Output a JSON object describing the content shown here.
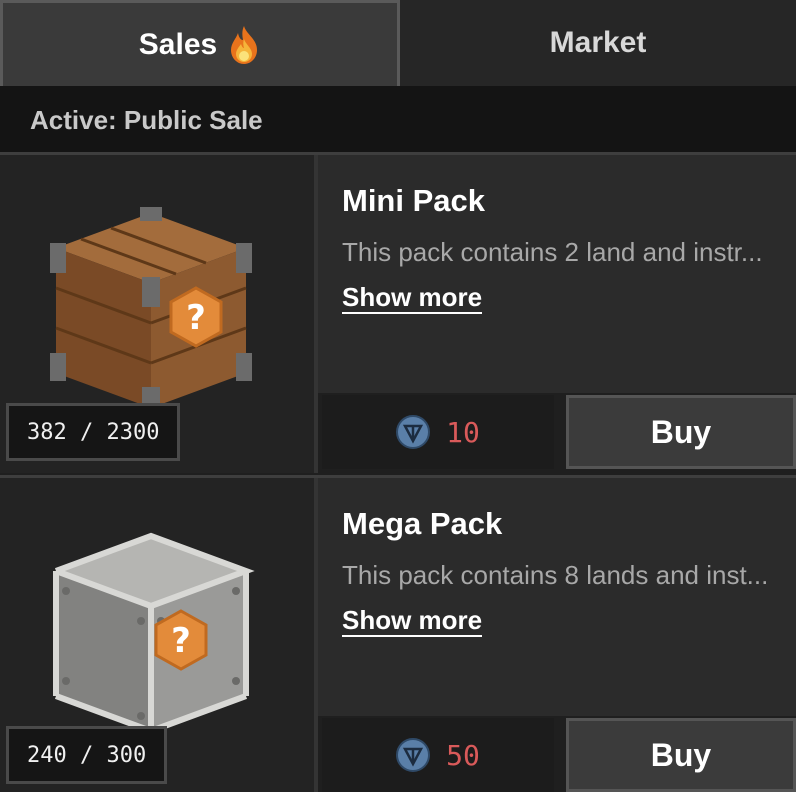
{
  "tabs": [
    {
      "label": "Sales",
      "icon": "flame-icon",
      "active": true
    },
    {
      "label": "Market",
      "active": false
    }
  ],
  "active_label": "Active: Public Sale",
  "packs": [
    {
      "title": "Mini Pack",
      "description": "This pack contains 2 land and instr...",
      "show_more": "Show more",
      "stock": "382 / 2300",
      "price": "10",
      "currency_icon": "ton-coin-icon",
      "buy_label": "Buy",
      "crate": "wooden-crate"
    },
    {
      "title": "Mega Pack",
      "description": "This pack contains 8 lands and inst...",
      "show_more": "Show more",
      "stock": "240 / 300",
      "price": "50",
      "currency_icon": "ton-coin-icon",
      "buy_label": "Buy",
      "crate": "metal-crate"
    }
  ],
  "colors": {
    "price": "#d95a5a",
    "coin": "#5a7fa8",
    "mystery_badge": "#e38b3a",
    "wood_crate": "#8a5a32",
    "metal_crate": "#9a9a98"
  }
}
